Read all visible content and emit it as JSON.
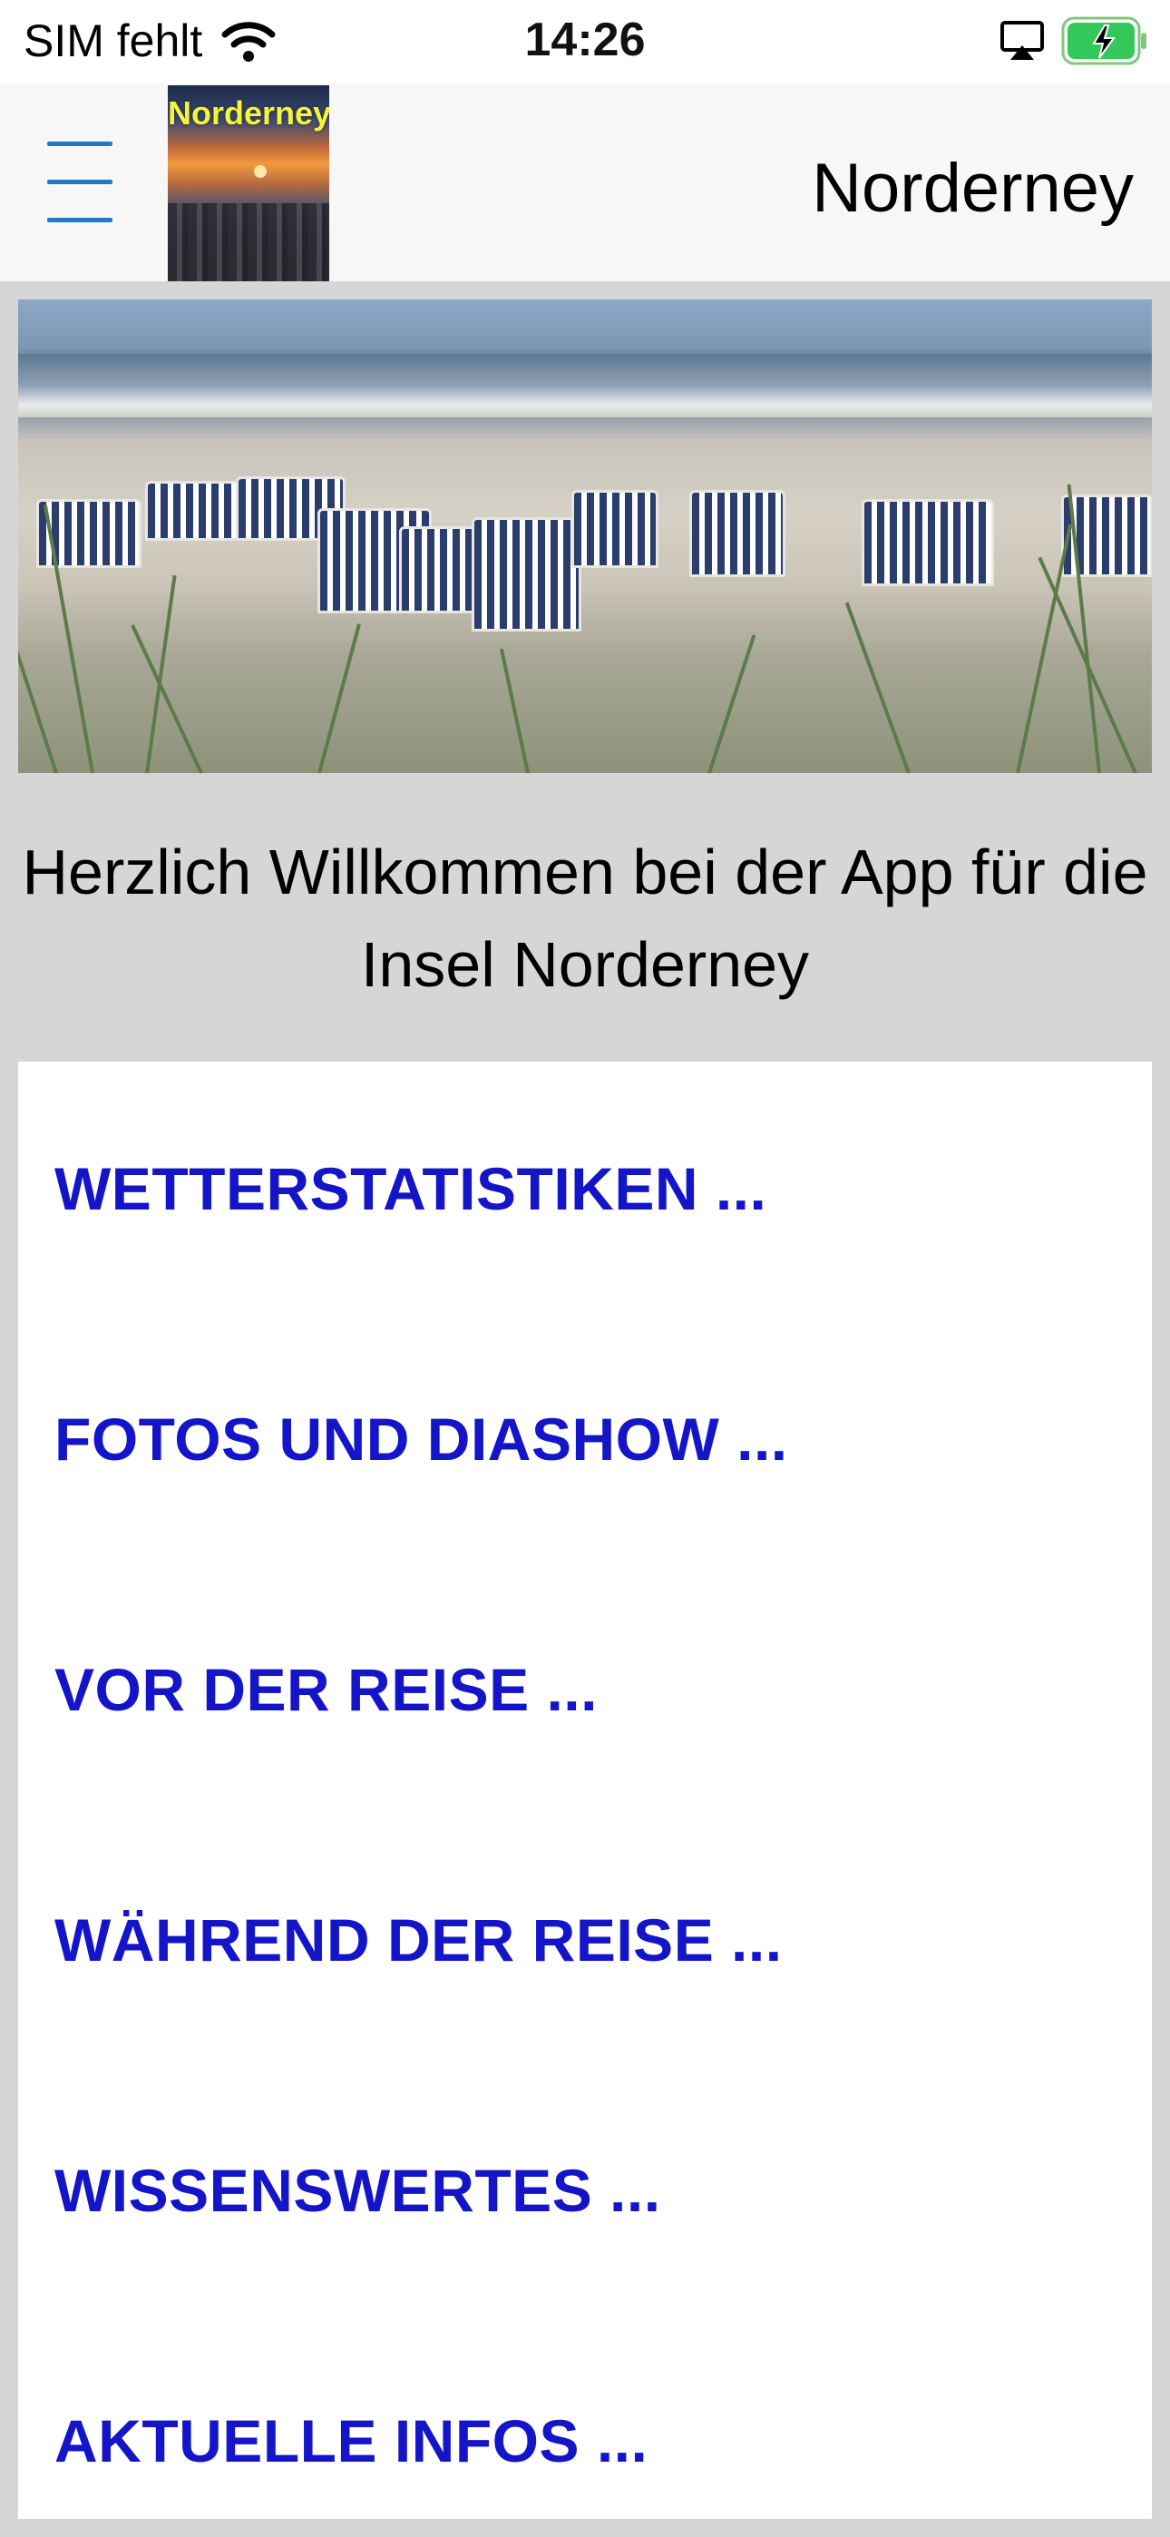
{
  "status_bar": {
    "carrier": "SIM fehlt",
    "time": "14:26",
    "icons": [
      "wifi-icon",
      "airplay-icon",
      "battery-charging-icon"
    ]
  },
  "nav": {
    "title": "Norderney",
    "logo_text": "Norderney",
    "menu_icon": "hamburger-menu-icon"
  },
  "hero": {
    "image": "beach-chairs-photo"
  },
  "welcome": {
    "line1": "Herzlich Willkommen bei der App für die",
    "line2": "Insel Norderney"
  },
  "menu": {
    "items": [
      {
        "label": "WETTERSTATISTIKEN ..."
      },
      {
        "label": "FOTOS UND DIASHOW ..."
      },
      {
        "label": "VOR DER REISE ..."
      },
      {
        "label": "WÄHREND DER REISE ..."
      },
      {
        "label": "WISSENSWERTES ..."
      },
      {
        "label": "AKTUELLE INFOS ..."
      }
    ]
  },
  "colors": {
    "link": "#1414c8",
    "menu_icon": "#1e7bc7",
    "logo_text": "#f4f43a",
    "battery": "#34c759",
    "page_bg": "#d6d6d6"
  }
}
